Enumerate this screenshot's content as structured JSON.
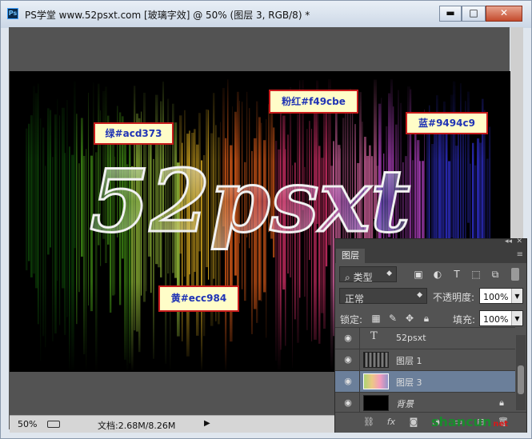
{
  "window": {
    "title": "PS学堂 www.52psxt.com [玻璃字效] @ 50% (图层 3, RGB/8) *",
    "app_icon": "Ps",
    "controls": {
      "minimize": "▬",
      "maximize": "□",
      "close": "✕"
    }
  },
  "canvas": {
    "artwork_text": "52psxt",
    "callouts": [
      {
        "label": "绿#acd373",
        "color": "#acd373"
      },
      {
        "label": "粉红#f49cbe",
        "color": "#f49cbe"
      },
      {
        "label": "蓝#9494c9",
        "color": "#9494c9"
      },
      {
        "label": "黄#ecc984",
        "color": "#ecc984"
      }
    ]
  },
  "statusbar": {
    "zoom": "50%",
    "doc_size": "文档:2.68M/8.26M"
  },
  "layers_panel": {
    "tab": "图层",
    "filter_kind": "类型",
    "blend_mode": "正常",
    "opacity_label": "不透明度:",
    "opacity_value": "100%",
    "lock_label": "锁定:",
    "fill_label": "填充:",
    "fill_value": "100%",
    "layers": [
      {
        "name": "52psxt",
        "kind": "text",
        "selected": false
      },
      {
        "name": "图层 1",
        "kind": "raster",
        "selected": false
      },
      {
        "name": "图层 3",
        "kind": "raster",
        "selected": true
      },
      {
        "name": "背景",
        "kind": "background",
        "selected": false,
        "locked": true
      }
    ]
  },
  "watermark": {
    "text": "shancun",
    "sub": "net"
  }
}
